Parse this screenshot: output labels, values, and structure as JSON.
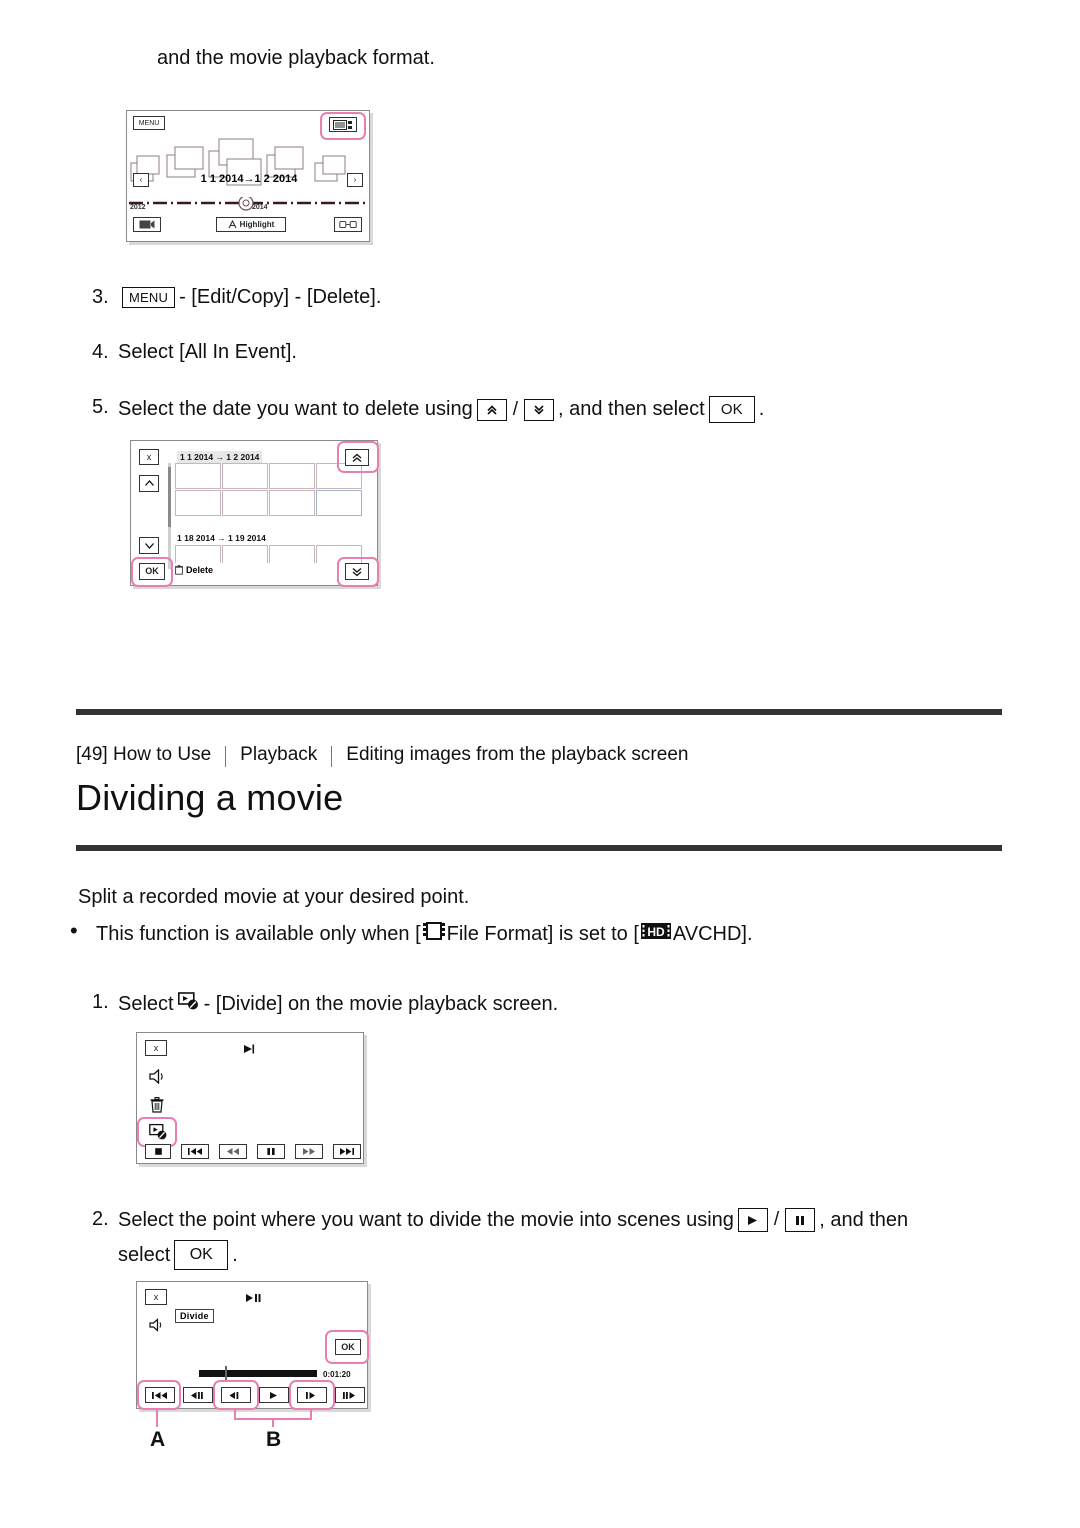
{
  "top_paragraph": "and the movie playback format.",
  "figure_event_index": {
    "menu_label": "MENU",
    "date_range": "1 1 2014→1 2 2014",
    "timeline_start_year": "2012",
    "timeline_end_year": "2014",
    "highlight_label": "Highlight",
    "prev_label": "‹",
    "next_label": "›",
    "highlight_color": "#e87fb0"
  },
  "steps_delete": [
    {
      "num": "3.",
      "parts": [
        "",
        " - [Edit/Copy] - [Delete]."
      ],
      "menu_key": "MENU"
    },
    {
      "num": "4.",
      "text": "Select [All In Event]."
    },
    {
      "num": "5.",
      "text_before": "Select the date you want to delete using",
      "text_middle": ", and then select",
      "text_after": ".",
      "ok_label": "OK",
      "up_icon": "double-chevron-up-icon",
      "down_icon": "double-chevron-down-icon"
    }
  ],
  "figure_date_select": {
    "close_label": "x",
    "date_row_1": "1 1 2014 → 1 2 2014",
    "date_row_2": "1 18 2014 → 1 19 2014",
    "ok_label": "OK",
    "delete_label": "Delete",
    "up_icon": "chevron-up-icon",
    "down_icon": "chevron-down-icon",
    "page_up_icon": "double-chevron-up-icon",
    "page_down_icon": "double-chevron-down-icon"
  },
  "section": {
    "breadcrumb": [
      "[49] How to Use",
      "Playback",
      "Editing images from the playback screen"
    ],
    "title": "Dividing a movie"
  },
  "intro": {
    "lead": "Split a recorded movie at your desired point.",
    "bullet_before": "This function is available only when [",
    "bullet_mid": "File Format] is set to [",
    "bullet_after": "AVCHD].",
    "film_icon": "film-frame-icon",
    "hd_icon": "hd-badge-icon",
    "hd_text": "HD"
  },
  "steps_divide": [
    {
      "num": "1.",
      "text_before": "Select",
      "text_after": "- [Divide] on the movie playback screen.",
      "divide_icon": "divide-movie-icon"
    },
    {
      "num": "2.",
      "text_before": "Select the point where you want to divide the movie into scenes using",
      "text_middle": ", and then",
      "text_line2_before": "select",
      "text_line2_after": ".",
      "play_icon": "play-icon",
      "pause_icon": "pause-icon",
      "ok_label": "OK"
    }
  ],
  "figure_playback": {
    "close_label": "x",
    "volume_icon": "speaker-icon",
    "trash_icon": "trash-icon",
    "divide_icon": "divide-movie-icon",
    "play_indicator": "▶",
    "controls": [
      "stop-icon",
      "skip-back-icon",
      "rewind-icon",
      "pause-icon",
      "fast-forward-icon",
      "skip-forward-icon"
    ]
  },
  "figure_divide": {
    "close_label": "x",
    "divide_label": "Divide",
    "volume_icon": "speaker-icon",
    "play_pause_indicator": "▶‖",
    "ok_label": "OK",
    "timecode": "0:01:20",
    "controls": [
      "skip-start-icon",
      "step-back-icon",
      "frame-back-icon",
      "play-icon",
      "frame-forward-icon",
      "step-forward-icon"
    ],
    "caption_a": "A",
    "caption_b": "B"
  }
}
